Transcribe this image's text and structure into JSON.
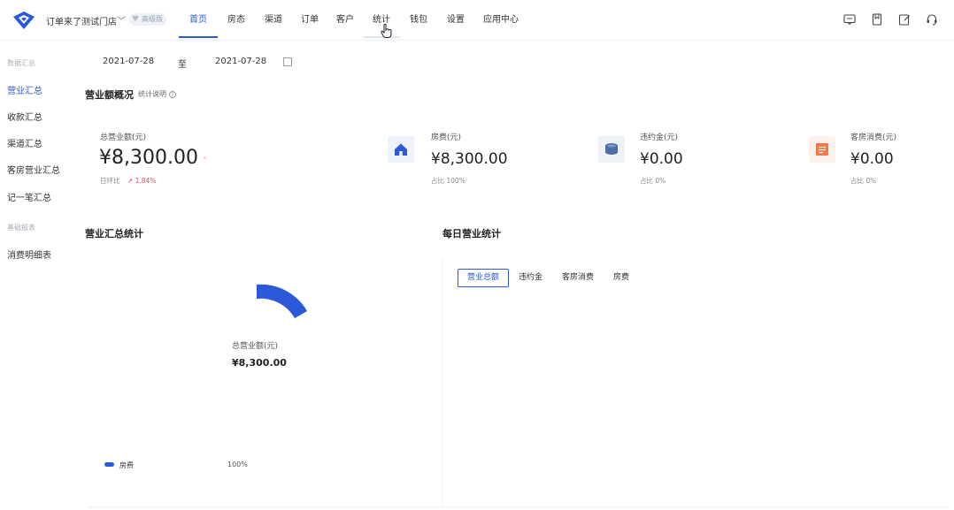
{
  "header": {
    "store_name": "订单来了测试门店",
    "badge": "高级版",
    "nav": [
      {
        "label": "首页",
        "active": true
      },
      {
        "label": "房态"
      },
      {
        "label": "渠道"
      },
      {
        "label": "订单"
      },
      {
        "label": "客户"
      },
      {
        "label": "统计",
        "hover": true
      },
      {
        "label": "钱包"
      },
      {
        "label": "设置"
      },
      {
        "label": "应用中心"
      }
    ],
    "icons": [
      "message-icon",
      "bookmark-icon",
      "edit-icon",
      "headset-icon"
    ]
  },
  "sidebar": {
    "group1": "数据汇总",
    "items1": [
      "营业汇总",
      "收款汇总",
      "渠道汇总",
      "客房营业汇总",
      "记一笔汇总"
    ],
    "active_index": 0,
    "group2": "基础报表",
    "items2": [
      "消费明细表"
    ]
  },
  "filter": {
    "start_date": "2021-07-28",
    "separator": "至",
    "end_date": "2021-07-28"
  },
  "overview": {
    "title": "营业额概况",
    "note": "统计说明",
    "total": {
      "label": "总营业额(元)",
      "value": "¥8,300.00",
      "compare_label": "日环比",
      "trend": "1.84%"
    },
    "cards": [
      {
        "label": "房费(元)",
        "value": "¥8,300.00",
        "sub": "占比 100%",
        "icon": "house-icon",
        "color": "#2b59d9"
      },
      {
        "label": "违约金(元)",
        "value": "¥0.00",
        "sub": "占比 0%",
        "icon": "coins-icon",
        "color": "#4a6fa5"
      },
      {
        "label": "客房消费(元)",
        "value": "¥0.00",
        "sub": "占比 0%",
        "icon": "receipt-icon",
        "color": "#f07a4a"
      }
    ]
  },
  "summary_chart": {
    "title": "营业汇总统计",
    "center_label": "总营业额(元)",
    "center_value": "¥8,300.00",
    "legend": [
      {
        "name": "房费",
        "percent": "100%",
        "color": "#2b59d9"
      }
    ]
  },
  "daily_chart": {
    "title": "每日营业统计",
    "tabs": [
      "营业总额",
      "违约金",
      "客房消费",
      "房费"
    ],
    "active_tab": 0
  }
}
